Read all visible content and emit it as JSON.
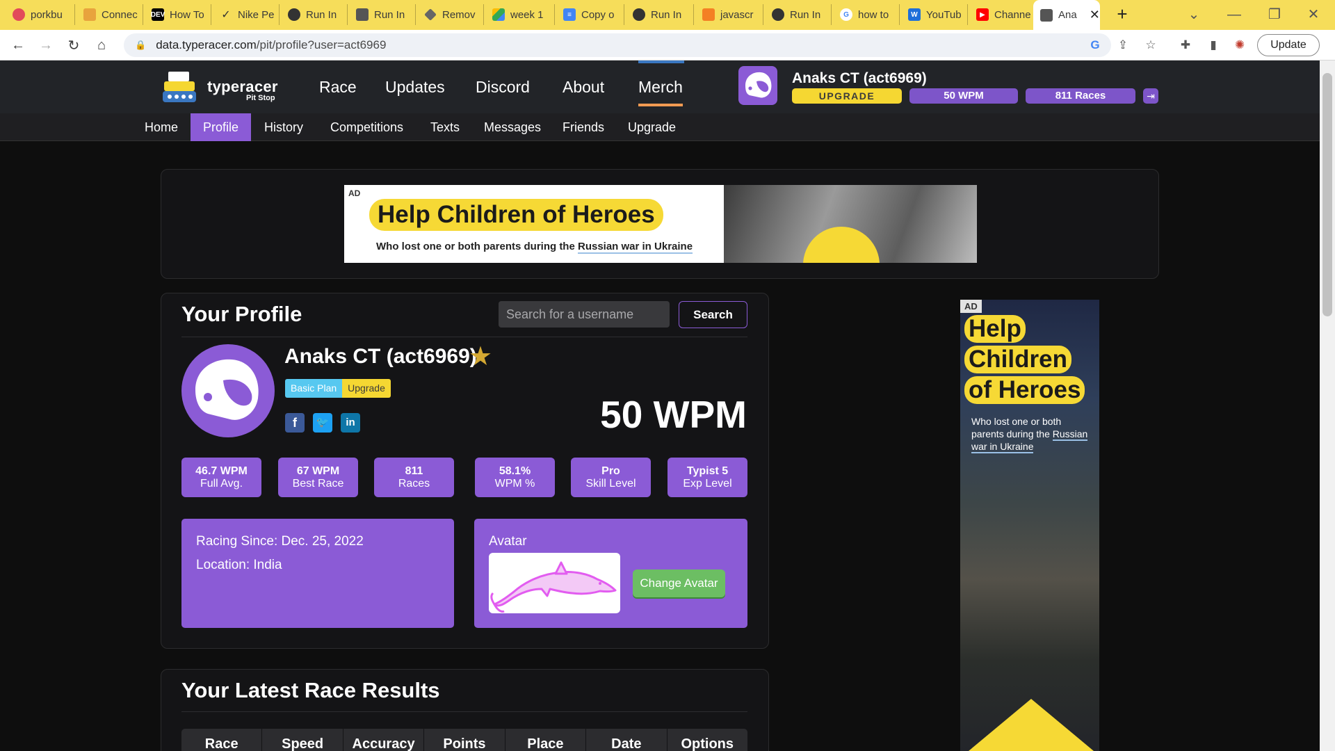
{
  "browser": {
    "tabs": [
      {
        "label": "porkbu",
        "icon": "porkbun-icon",
        "color": "#e24a5a"
      },
      {
        "label": "Connec",
        "icon": "box-icon",
        "color": "#e8a33d"
      },
      {
        "label": "How To",
        "icon": "dev-icon",
        "color": "#000000"
      },
      {
        "label": "Nike Pe",
        "icon": "nike-icon",
        "color": "#333333"
      },
      {
        "label": "Run In",
        "icon": "globe-icon",
        "color": "#333333"
      },
      {
        "label": "Run In",
        "icon": "typewriter-icon",
        "color": "#555555"
      },
      {
        "label": "Remov",
        "icon": "layers-icon",
        "color": "#666666"
      },
      {
        "label": "week 1",
        "icon": "drive-icon",
        "color": "#34a853"
      },
      {
        "label": "Copy o",
        "icon": "docs-icon",
        "color": "#4285f4"
      },
      {
        "label": "Run In",
        "icon": "globe-icon",
        "color": "#333333"
      },
      {
        "label": "javascr",
        "icon": "stack-icon",
        "color": "#f48024"
      },
      {
        "label": "Run In",
        "icon": "globe-icon",
        "color": "#333333"
      },
      {
        "label": "how to",
        "icon": "google-icon",
        "color": "#4285f4"
      },
      {
        "label": "YouTub",
        "icon": "w-icon",
        "color": "#1e6fd9"
      },
      {
        "label": "Channe",
        "icon": "youtube-icon",
        "color": "#ff0000"
      },
      {
        "label": "Ana",
        "icon": "typewriter-icon",
        "color": "#555555"
      }
    ],
    "url_host": "data.typeracer.com",
    "url_path": "/pit/profile?user=act6969",
    "update_label": "Update"
  },
  "site": {
    "brand": "typeracer",
    "brand_sub": "Pit Stop",
    "nav": [
      "Race",
      "Updates",
      "Discord",
      "About",
      "Merch"
    ],
    "user_name": "Anaks CT (act6969)",
    "upgrade": "UPGRADE",
    "wpm": "50  WPM",
    "races": "811 Races",
    "subnav": [
      "Home",
      "Profile",
      "History",
      "Competitions",
      "Texts",
      "Messages",
      "Friends",
      "Upgrade"
    ]
  },
  "ad": {
    "tag": "AD",
    "headline": "Help Children of Heroes",
    "sub_pre": "Who lost one or both parents during the ",
    "sub_link": "Russian war in Ukraine"
  },
  "side_ad": {
    "tag": "AD",
    "lines": [
      "Help",
      "Children",
      "of Heroes"
    ],
    "sub_pre": "Who lost one or both parents during the ",
    "sub_link": "Russian war in Ukraine"
  },
  "profile": {
    "title": "Your Profile",
    "search_placeholder": "Search for a username",
    "search_button": "Search",
    "name": "Anaks CT (act6969)",
    "plan_basic": "Basic Plan",
    "plan_upgrade": "Upgrade",
    "big_wpm": "50 WPM",
    "stats": [
      {
        "value": "46.7 WPM",
        "label": "Full Avg."
      },
      {
        "value": "67 WPM",
        "label": "Best Race"
      },
      {
        "value": "811",
        "label": "Races"
      },
      {
        "value": "58.1%",
        "label": "WPM %"
      },
      {
        "value": "Pro",
        "label": "Skill Level"
      },
      {
        "value": "Typist 5",
        "label": "Exp Level"
      }
    ],
    "racing_since": "Racing Since: Dec. 25, 2022",
    "location": "Location: India",
    "avatar_label": "Avatar",
    "change_avatar": "Change Avatar"
  },
  "results": {
    "title": "Your Latest Race Results",
    "columns": [
      "Race",
      "Speed",
      "Accuracy",
      "Points",
      "Place",
      "Date",
      "Options"
    ]
  },
  "colors": {
    "accent_purple": "#8b5bd6",
    "upgrade_yellow": "#f5d732",
    "avatar_green": "#6cbe63",
    "tabbar_yellow": "#f6dd5a"
  }
}
